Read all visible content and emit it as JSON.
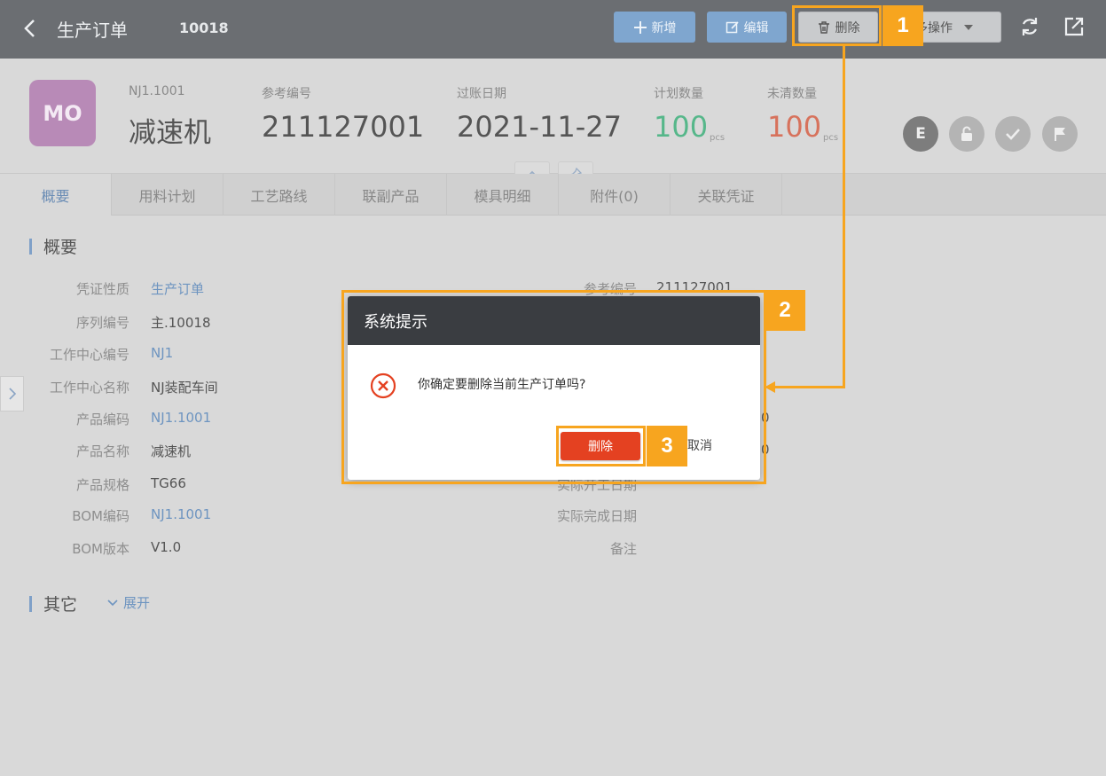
{
  "topbar": {
    "title": "生产订单",
    "doc_no": "10018",
    "buttons": {
      "add": "新增",
      "edit": "编辑",
      "delete": "删除",
      "more": "多操作"
    }
  },
  "header": {
    "avatar": "MO",
    "product_code": "NJ1.1001",
    "product_name": "减速机",
    "ref_label": "参考编号",
    "ref_value": "211127001",
    "post_date_label": "过账日期",
    "post_date_value": "2021-11-27",
    "plan_qty_label": "计划数量",
    "plan_qty_value": "100",
    "plan_qty_unit": "pcs",
    "open_qty_label": "未清数量",
    "open_qty_value": "100",
    "open_qty_unit": "pcs",
    "status_letter": "E"
  },
  "tabs": [
    "概要",
    "用料计划",
    "工艺路线",
    "联副产品",
    "模具明细",
    "附件(0)",
    "关联凭证"
  ],
  "overview": {
    "section_title": "概要",
    "left_fields": [
      {
        "label": "凭证性质",
        "value": "生产订单"
      },
      {
        "label": "序列编号",
        "value": "主.10018"
      },
      {
        "label": "工作中心编号",
        "value": "NJ1"
      },
      {
        "label": "工作中心名称",
        "value": "NJ装配车间"
      },
      {
        "label": "产品编码",
        "value": "NJ1.1001"
      },
      {
        "label": "产品名称",
        "value": "减速机"
      },
      {
        "label": "产品规格",
        "value": "TG66"
      },
      {
        "label": "BOM编码",
        "value": "NJ1.1001"
      },
      {
        "label": "BOM版本",
        "value": "V1.0"
      }
    ],
    "right_fields": [
      {
        "label": "参考编号",
        "value": "211127001"
      },
      {
        "label": "实际开工日期",
        "value": ""
      },
      {
        "label": "实际完成日期",
        "value": ""
      },
      {
        "label": "备注",
        "value": ""
      }
    ],
    "partial_values": [
      "0",
      "0"
    ]
  },
  "other": {
    "section_title": "其它",
    "expand_label": "展开"
  },
  "dialog": {
    "title": "系统提示",
    "message": "你确定要删除当前生产订单吗?",
    "confirm_label": "删除",
    "cancel_label": "取消"
  },
  "annotations": [
    "1",
    "2",
    "3"
  ],
  "colors": {
    "annotation": "#f7a51f",
    "primary_button": "#7fa6cf",
    "danger_button": "#e44121",
    "topbar": "#6b6e72",
    "link": "#6d94c0"
  }
}
